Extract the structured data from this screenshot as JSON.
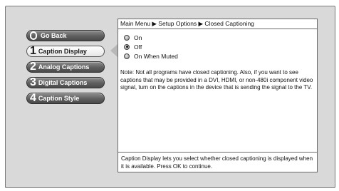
{
  "menu": {
    "items": [
      {
        "number": "0",
        "label": "Go Back",
        "selected": false
      },
      {
        "number": "1",
        "label": "Caption Display",
        "selected": true
      },
      {
        "number": "2",
        "label": "Analog Captions",
        "selected": false
      },
      {
        "number": "3",
        "label": "Digital Captions",
        "selected": false
      },
      {
        "number": "4",
        "label": "Caption Style",
        "selected": false
      }
    ]
  },
  "panel": {
    "breadcrumb": "Main Menu ▶ Setup Options ▶ Closed Captioning",
    "options": [
      {
        "label": "On",
        "checked": false
      },
      {
        "label": "Off",
        "checked": true
      },
      {
        "label": "On When Muted",
        "checked": false
      }
    ],
    "note": "Note: Not all programs have closed captioning. Also, if you want to see captions that may be provided in a DVI, HDMI, or non-480i component video signal, turn on the captions in the device that is sending the signal to the TV.",
    "help": "Caption Display lets you select whether closed captioning is displayed when it is available. Press OK to continue."
  }
}
